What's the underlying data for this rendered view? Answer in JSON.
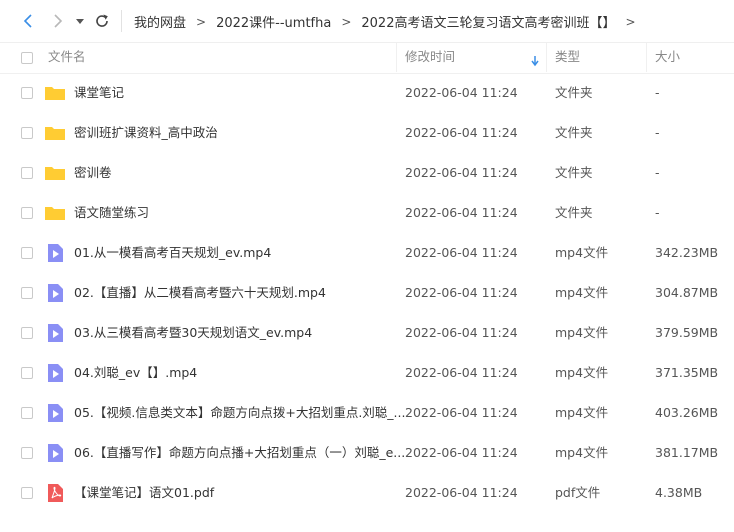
{
  "breadcrumb": [
    "我的网盘",
    "2022课件--umtfha",
    "2022高考语文三轮复习语文高考密训班【】"
  ],
  "breadcrumb_arrow": ">",
  "columns": {
    "name": "文件名",
    "modified": "修改时间",
    "type": "类型",
    "size": "大小"
  },
  "sort_icon": "arrow-down-icon",
  "colors": {
    "folder": "#ffcc33",
    "video": "#8a8ff5",
    "pdf": "#f05a5a",
    "nav_active": "#3a8ee6",
    "sort": "#3a8ee6"
  },
  "files": [
    {
      "name": "课堂笔记",
      "modified": "2022-06-04 11:24",
      "type": "文件夹",
      "size": "-",
      "icon": "folder"
    },
    {
      "name": "密训班扩课资料_高中政治",
      "modified": "2022-06-04 11:24",
      "type": "文件夹",
      "size": "-",
      "icon": "folder"
    },
    {
      "name": "密训卷",
      "modified": "2022-06-04 11:24",
      "type": "文件夹",
      "size": "-",
      "icon": "folder"
    },
    {
      "name": "语文随堂练习",
      "modified": "2022-06-04 11:24",
      "type": "文件夹",
      "size": "-",
      "icon": "folder"
    },
    {
      "name": "01.从一模看高考百天规划_ev.mp4",
      "modified": "2022-06-04 11:24",
      "type": "mp4文件",
      "size": "342.23MB",
      "icon": "video"
    },
    {
      "name": "02.【直播】从二模看高考暨六十天规划.mp4",
      "modified": "2022-06-04 11:24",
      "type": "mp4文件",
      "size": "304.87MB",
      "icon": "video"
    },
    {
      "name": "03.从三模看高考暨30天规划语文_ev.mp4",
      "modified": "2022-06-04 11:24",
      "type": "mp4文件",
      "size": "379.59MB",
      "icon": "video"
    },
    {
      "name": "04.刘聪_ev【】.mp4",
      "modified": "2022-06-04 11:24",
      "type": "mp4文件",
      "size": "371.35MB",
      "icon": "video"
    },
    {
      "name": "05.【视频.信息类文本】命题方向点拨+大招划重点.刘聪_...",
      "modified": "2022-06-04 11:24",
      "type": "mp4文件",
      "size": "403.26MB",
      "icon": "video"
    },
    {
      "name": "06.【直播写作】命题方向点播+大招划重点（一）刘聪_e...",
      "modified": "2022-06-04 11:24",
      "type": "mp4文件",
      "size": "381.17MB",
      "icon": "video"
    },
    {
      "name": "【课堂笔记】语文01.pdf",
      "modified": "2022-06-04 11:24",
      "type": "pdf文件",
      "size": "4.38MB",
      "icon": "pdf"
    }
  ]
}
